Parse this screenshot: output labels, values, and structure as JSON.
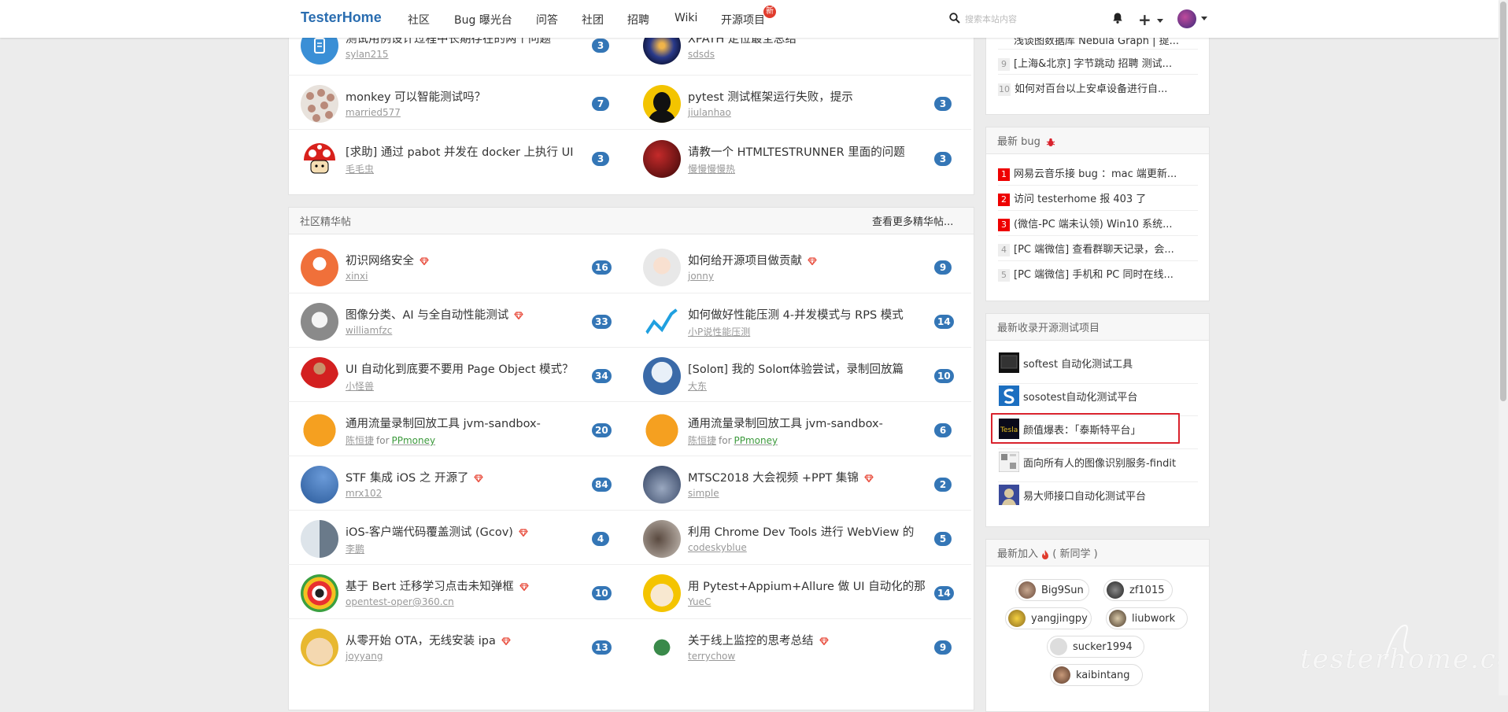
{
  "nav": {
    "brand": "TesterHome",
    "items": [
      "社区",
      "Bug 曝光台",
      "问答",
      "社团",
      "招聘",
      "Wiki",
      "开源项目"
    ],
    "new_badge": "新",
    "search_placeholder": "搜索本站内容",
    "plus": "+"
  },
  "top_topics": [
    {
      "title": "测试用例设计过程中长期存在的两个问题",
      "author": "sylan215",
      "count": "3",
      "avatar": "blue-icon"
    },
    {
      "title": "XPATH 定位最全总结",
      "author": "sdsds",
      "count": "",
      "avatar": "galaxy"
    },
    {
      "title": "monkey 可以智能测试吗？",
      "author": "married577",
      "count": "7",
      "avatar": "faces"
    },
    {
      "title": "pytest 测试框架运行失败，提示",
      "author": "jiulanhao",
      "count": "3",
      "avatar": "silhouette"
    },
    {
      "title": "[求助] 通过 pabot 并发在 docker 上执行 UI",
      "author": "毛毛虫",
      "count": "3",
      "avatar": "mushroom"
    },
    {
      "title": "请教一个 HTMLTESTRUNNER 里面的问题",
      "author": "慢慢慢慢热",
      "count": "3",
      "avatar": "red-dark"
    }
  ],
  "excellent": {
    "header": "社区精华帖",
    "more_link": "查看更多精华帖...",
    "topics": [
      {
        "title": "初识网络安全",
        "author": "xinxi",
        "count": "16",
        "diamond": true,
        "avatar": "orange-person"
      },
      {
        "title": "如何给开源项目做贡献",
        "author": "jonny",
        "count": "9",
        "diamond": true,
        "avatar": "baby"
      },
      {
        "title": "图像分类、AI 与全自动性能测试",
        "author": "williamfzc",
        "count": "33",
        "diamond": true,
        "avatar": "cat"
      },
      {
        "title": "如何做好性能压测 4-并发模式与 RPS 模式",
        "author": "小P说性能压测",
        "count": "14",
        "diamond": false,
        "avatar": "chart"
      },
      {
        "title": "UI 自动化到底要不要用 Page Object 模式？",
        "author": "小怪兽",
        "count": "34",
        "diamond": false,
        "avatar": "basketball"
      },
      {
        "title": "[Soloπ] 我的 Soloπ体验尝试，录制回放篇",
        "author": "大东",
        "count": "10",
        "diamond": false,
        "avatar": "ghost"
      },
      {
        "title": "通用流量录制回放工具 jvm-sandbox-",
        "author": "陈恒捷",
        "for": "for",
        "team": "PPmoney",
        "count": "20",
        "diamond": false,
        "avatar": "koro"
      },
      {
        "title": "通用流量录制回放工具 jvm-sandbox-",
        "author": "陈恒捷",
        "for": "for",
        "team": "PPmoney",
        "count": "6",
        "diamond": false,
        "avatar": "koro"
      },
      {
        "title": "STF 集成 iOS 之 开源了",
        "author": "mrx102",
        "count": "84",
        "diamond": true,
        "avatar": "golf"
      },
      {
        "title": "MTSC2018 大会视频 +PPT 集锦",
        "author": "simple",
        "count": "2",
        "diamond": true,
        "avatar": "night"
      },
      {
        "title": "iOS-客户端代码覆盖测试 (Gcov)",
        "author": "李鹏",
        "count": "4",
        "diamond": true,
        "avatar": "street"
      },
      {
        "title": "利用 Chrome Dev Tools 进行 WebView 的",
        "author": "codeskyblue",
        "count": "5",
        "diamond": false,
        "avatar": "hand"
      },
      {
        "title": "基于 Bert 迁移学习点击未知弹框",
        "author": "opentest-oper@360.cn",
        "count": "10",
        "diamond": true,
        "avatar": "eye"
      },
      {
        "title": "用 Pytest+Appium+Allure 做 UI 自动化的那",
        "author": "YueC",
        "count": "14",
        "diamond": false,
        "avatar": "cartoon"
      },
      {
        "title": "从零开始 OTA，无线安装 ipa",
        "author": "joyyang",
        "count": "13",
        "diamond": true,
        "avatar": "luffy"
      },
      {
        "title": "关于线上监控的思考总结",
        "author": "terrychow",
        "count": "9",
        "diamond": true,
        "avatar": "monster"
      }
    ]
  },
  "sidebar": {
    "top_items": [
      {
        "num": "",
        "text": "浅谈图数据库 Nebula Graph | 提..."
      },
      {
        "num": "9",
        "text": "[上海&北京] 字节跳动 招聘 测试..."
      },
      {
        "num": "10",
        "text": "如何对百台以上安卓设备进行自..."
      }
    ],
    "bugs_header": "最新 bug",
    "bugs": [
      {
        "num": "1",
        "text": "网易云音乐接 bug ：mac 端更新...",
        "red": true
      },
      {
        "num": "2",
        "text": "访问 testerhome 报 403 了",
        "red": true
      },
      {
        "num": "3",
        "text": "(微信-PC 端未认领) Win10 系统...",
        "red": true
      },
      {
        "num": "4",
        "text": "[PC 端微信] 查看群聊天记录，会...",
        "red": false
      },
      {
        "num": "5",
        "text": "[PC 端微信] 手机和 PC 同时在线...",
        "red": false
      }
    ],
    "projects_header": "最新收录开源测试项目",
    "projects": [
      {
        "name": "softest 自动化测试工具"
      },
      {
        "name": "sosotest自动化测试平台"
      },
      {
        "name": "颜值爆表：「泰斯特平台」"
      },
      {
        "name": "面向所有人的图像识别服务-findit"
      },
      {
        "name": "易大师接口自动化测试平台"
      }
    ],
    "newusers_header": "最新加入",
    "newusers_suffix": "( 新同学 )",
    "users": [
      "Big9Sun",
      "zf1015",
      "yangjingpy",
      "liubwork",
      "sucker1994",
      "kaibintang"
    ]
  },
  "watermark": "testerhome.com",
  "colors": {
    "brand": "#2a6db0",
    "badge": "#3476b6",
    "bug_red": "#e00000",
    "team_green": "#3c9a3c",
    "highlight": "#d9232d"
  }
}
